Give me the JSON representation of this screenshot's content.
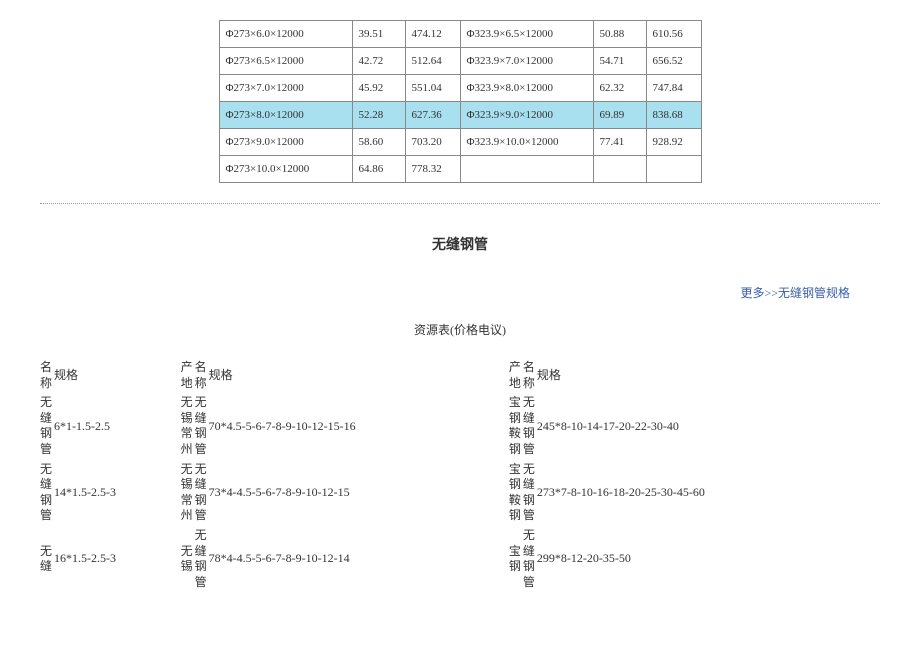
{
  "top_table": {
    "rows": [
      {
        "s1": "Φ273×6.0×12000",
        "a1": "39.51",
        "b1": "474.12",
        "s2": "Φ323.9×6.5×12000",
        "a2": "50.88",
        "b2": "610.56",
        "hl": false
      },
      {
        "s1": "Φ273×6.5×12000",
        "a1": "42.72",
        "b1": "512.64",
        "s2": "Φ323.9×7.0×12000",
        "a2": "54.71",
        "b2": "656.52",
        "hl": false
      },
      {
        "s1": "Φ273×7.0×12000",
        "a1": "45.92",
        "b1": "551.04",
        "s2": "Φ323.9×8.0×12000",
        "a2": "62.32",
        "b2": "747.84",
        "hl": false
      },
      {
        "s1": "Φ273×8.0×12000",
        "a1": "52.28",
        "b1": "627.36",
        "s2": "Φ323.9×9.0×12000",
        "a2": "69.89",
        "b2": "838.68",
        "hl": true
      },
      {
        "s1": "Φ273×9.0×12000",
        "a1": "58.60",
        "b1": "703.20",
        "s2": "Φ323.9×10.0×12000",
        "a2": "77.41",
        "b2": "928.92",
        "hl": false
      },
      {
        "s1": "Φ273×10.0×12000",
        "a1": "64.86",
        "b1": "778.32",
        "s2": "",
        "a2": "",
        "b2": "",
        "hl": false
      }
    ]
  },
  "section_title": "无缝钢管",
  "more_link": "更多>>无缝钢管规格",
  "resource_title": "资源表(价格电议)",
  "headers": {
    "h1": "名称",
    "h2": "规格",
    "h3": "产地",
    "h4": "名称",
    "h5": "规格",
    "h6": "产地",
    "h7": "名称",
    "h8": "规格"
  },
  "resource_rows": [
    {
      "n1": "无缝钢管",
      "g1": "6*1-1.5-2.5",
      "p1": "无锡常州",
      "n2": "无缝钢管",
      "g2": "70*4.5-5-6-7-8-9-10-12-15-16",
      "p2": "宝钢鞍钢",
      "n3": "无缝钢管",
      "g3": "245*8-10-14-17-20-22-30-40"
    },
    {
      "n1": "无缝钢管",
      "g1": "14*1.5-2.5-3",
      "p1": "无锡常州",
      "n2": "无缝钢管",
      "g2": "73*4-4.5-5-6-7-8-9-10-12-15",
      "p2": "宝钢鞍钢",
      "n3": "无缝钢管",
      "g3": "273*7-8-10-16-18-20-25-30-45-60"
    },
    {
      "n1": "无缝",
      "g1": "16*1.5-2.5-3",
      "p1": "无锡",
      "n2": "无缝钢管",
      "g2": "78*4-4.5-5-6-7-8-9-10-12-14",
      "p2": "宝钢",
      "n3": "无缝钢管",
      "g3": "299*8-12-20-35-50"
    }
  ]
}
